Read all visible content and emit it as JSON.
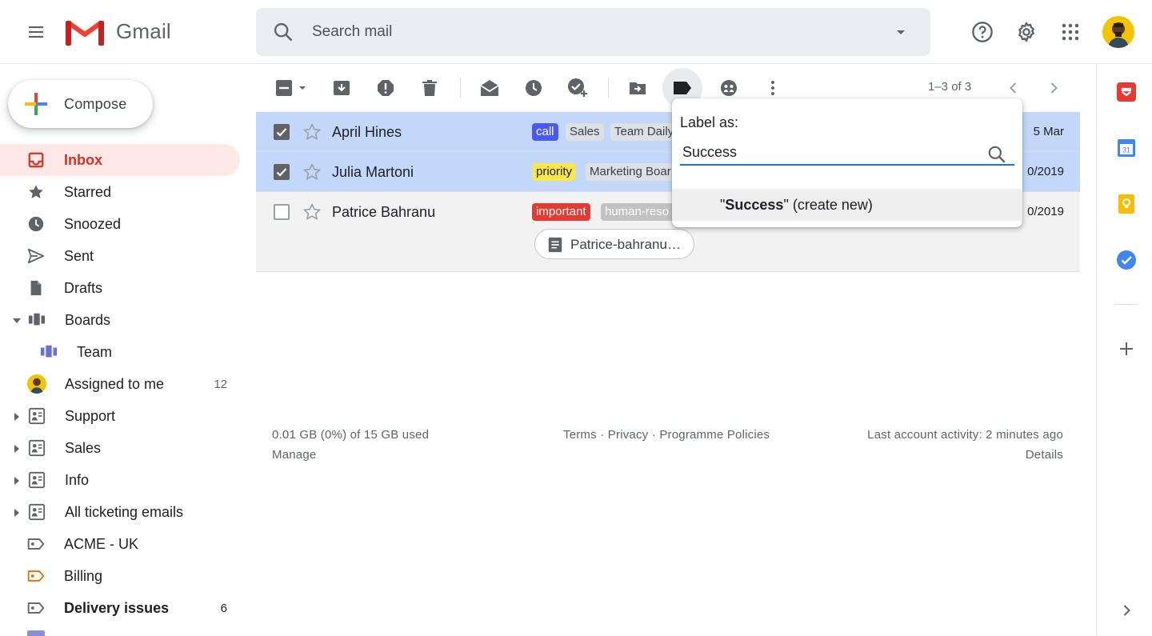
{
  "app": {
    "name": "Gmail"
  },
  "search": {
    "placeholder": "Search mail"
  },
  "compose": {
    "label": "Compose"
  },
  "sidebar": {
    "items": [
      {
        "label": "Inbox",
        "icon": "inbox-icon",
        "active": true
      },
      {
        "label": "Starred",
        "icon": "star-icon"
      },
      {
        "label": "Snoozed",
        "icon": "clock-icon"
      },
      {
        "label": "Sent",
        "icon": "send-icon"
      },
      {
        "label": "Drafts",
        "icon": "draft-icon"
      },
      {
        "label": "Boards",
        "icon": "board-icon"
      },
      {
        "label": "Team",
        "icon": "board-icon"
      },
      {
        "label": "Assigned to me",
        "icon": "avatar-icon",
        "count": "12"
      },
      {
        "label": "Support",
        "icon": "shared-label-icon"
      },
      {
        "label": "Sales",
        "icon": "shared-label-icon"
      },
      {
        "label": "Info",
        "icon": "shared-label-icon"
      },
      {
        "label": "All ticketing emails",
        "icon": "shared-label-icon"
      },
      {
        "label": "ACME - UK",
        "icon": "label-icon"
      },
      {
        "label": "Billing",
        "icon": "label-icon",
        "color": "#e8710a"
      },
      {
        "label": "Delivery issues",
        "icon": "label-icon",
        "count": "6",
        "bold": true
      }
    ]
  },
  "toolbar": {
    "pager": "1–3 of 3"
  },
  "emails": [
    {
      "sender": "April Hines",
      "selected": true,
      "labels": [
        "call",
        "Sales",
        "Team Daily"
      ],
      "date": "5 Mar"
    },
    {
      "sender": "Julia Martoni",
      "selected": true,
      "labels": [
        "priority",
        "Marketing Boar"
      ],
      "date": "0/2019"
    },
    {
      "sender": "Patrice Bahranu",
      "selected": false,
      "labels": [
        "important",
        "human-reso"
      ],
      "date": "0/2019",
      "attachment": "Patrice-bahranu…"
    }
  ],
  "label_colors": {
    "call": "#4a5af0",
    "priority": "#fbe74b",
    "important": "#e23b33",
    "human": "#c2c2c2",
    "grey": "#dde0e4"
  },
  "label_popup": {
    "title": "Label as:",
    "input_value": "Success",
    "option_quote_open": "\"",
    "option_name": "Success",
    "option_suffix": "\" (create new)"
  },
  "footer": {
    "storage": "0.01 GB (0%) of 15 GB used",
    "manage": "Manage",
    "terms": "Terms",
    "privacy": "Privacy",
    "policies": "Programme Policies",
    "sep": "·",
    "activity": "Last account activity: 2 minutes ago",
    "details": "Details"
  },
  "right_rail": {
    "calendar_day": "31"
  }
}
